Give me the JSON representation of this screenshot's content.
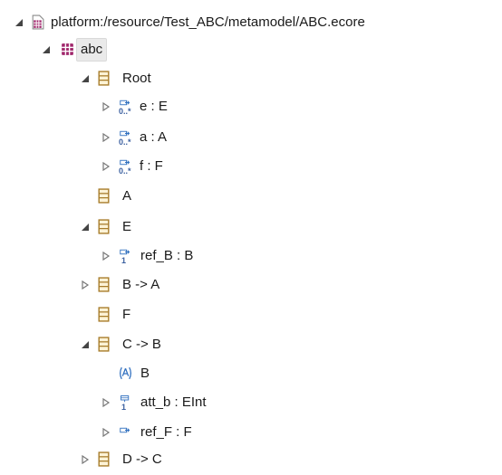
{
  "tree": {
    "root": {
      "label": "platform:/resource/Test_ABC/metamodel/ABC.ecore"
    },
    "package": {
      "label": "abc"
    },
    "nodes": [
      {
        "label": "Root"
      },
      {
        "label": "e : E"
      },
      {
        "label": "a : A"
      },
      {
        "label": "f : F"
      },
      {
        "label": "A"
      },
      {
        "label": "E"
      },
      {
        "label": "ref_B : B"
      },
      {
        "label": "B -> A"
      },
      {
        "label": "F"
      },
      {
        "label": "C -> B"
      },
      {
        "label": "B"
      },
      {
        "label": "att_b : EInt"
      },
      {
        "label": "ref_F : F"
      },
      {
        "label": "D -> C"
      }
    ],
    "multiplicity": {
      "many": "0..*",
      "one": "1"
    }
  },
  "colors": {
    "class_icon": "#e2b96b",
    "class_icon_border": "#a77c2a",
    "package_icon": "#a0266b",
    "reference_icon": "#2f6fbf",
    "twisty": "#555555"
  }
}
